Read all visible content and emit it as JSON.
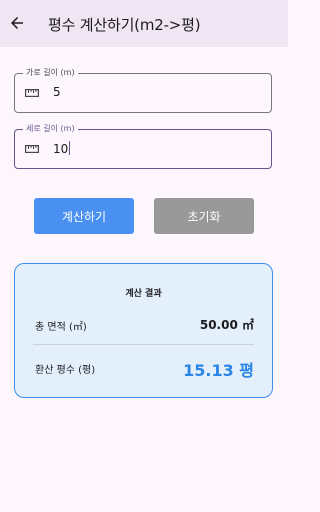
{
  "appbar": {
    "back_icon": "arrow-left-icon",
    "title": "평수 계산하기(m2->평)"
  },
  "inputs": {
    "width": {
      "label": "가로 길이 (m)",
      "value": "5",
      "icon": "ruler-icon"
    },
    "length": {
      "label": "세로 길이 (m)",
      "value": "10",
      "icon": "ruler-icon"
    }
  },
  "buttons": {
    "calculate": "계산하기",
    "reset": "초기화"
  },
  "result": {
    "title": "계산 결과",
    "area_label": "총 면적 (㎡)",
    "area_value": "50.00 ㎡",
    "pyeong_label": "환산 평수 (평)",
    "pyeong_value": "15.13 평"
  },
  "colors": {
    "accent": "#4a90f0",
    "result_highlight": "#2a86e6",
    "appbar": "#efe5f3",
    "focus": "#65558f"
  }
}
